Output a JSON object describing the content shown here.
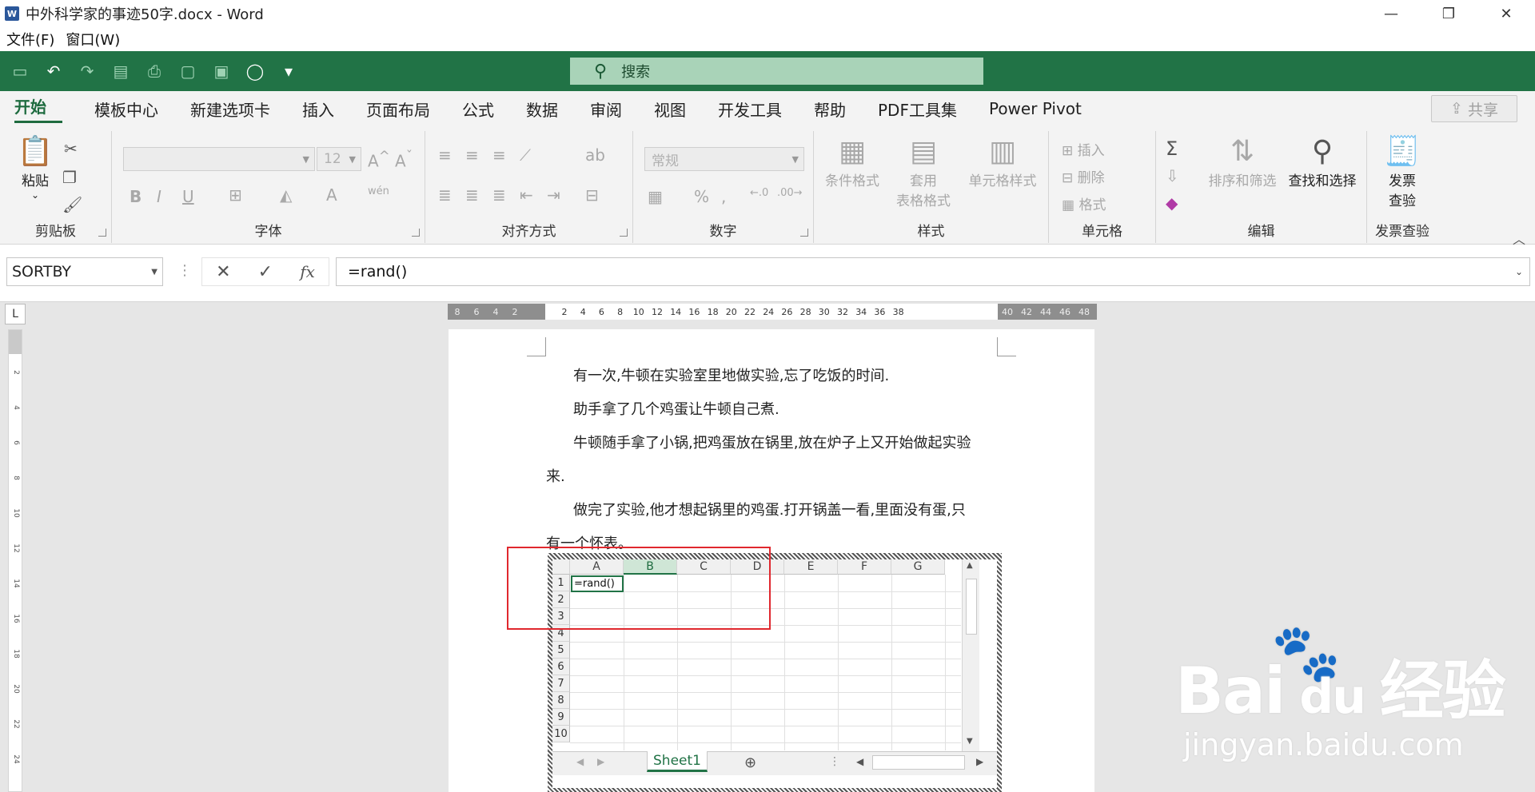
{
  "window": {
    "title": "中外科学家的事迹50字.docx - Word",
    "app_icon_letter": "W",
    "minimize": "—",
    "restore": "❐",
    "close": "✕"
  },
  "menu": {
    "items": [
      "文件(F)",
      "窗口(W)"
    ]
  },
  "qat": {
    "search_placeholder": "搜索"
  },
  "tabs": [
    "开始",
    "模板中心",
    "新建选项卡",
    "插入",
    "页面布局",
    "公式",
    "数据",
    "审阅",
    "视图",
    "开发工具",
    "帮助",
    "PDF工具集",
    "Power Pivot"
  ],
  "share_label": "共享",
  "ribbon": {
    "clipboard": {
      "paste": "粘贴",
      "label": "剪贴板"
    },
    "font": {
      "name": "",
      "size": "12",
      "label": "字体"
    },
    "align": {
      "label": "对齐方式"
    },
    "number": {
      "format": "常规",
      "label": "数字"
    },
    "styles": {
      "cond": "条件格式",
      "table_1": "套用",
      "table_2": "表格格式",
      "cell": "单元格样式",
      "label": "样式"
    },
    "cells": {
      "insert": "插入",
      "delete": "删除",
      "format": "格式",
      "label": "单元格"
    },
    "edit": {
      "sort": "排序和筛选",
      "find": "查找和选择",
      "label": "编辑"
    },
    "invoice": {
      "btn_1": "发票",
      "btn_2": "查验",
      "label": "发票查验"
    }
  },
  "formula_bar": {
    "name_box": "SORTBY",
    "formula": "=rand()",
    "fx": "fx"
  },
  "document": {
    "paragraphs": [
      "有一次,牛顿在实验室里地做实验,忘了吃饭的时间.",
      "助手拿了几个鸡蛋让牛顿自己煮.",
      "牛顿随手拿了小锅,把鸡蛋放在锅里,放在炉子上又开始做起实验",
      "来.",
      "做完了实验,他才想起锅里的鸡蛋.打开锅盖一看,里面没有蛋,只",
      "有一个怀表。"
    ]
  },
  "ruler": {
    "h_ticks_left": [
      "8",
      "6",
      "4",
      "2"
    ],
    "h_ticks_main": [
      "2",
      "4",
      "6",
      "8",
      "10",
      "12",
      "14",
      "16",
      "18",
      "20",
      "22",
      "24",
      "26",
      "28",
      "30",
      "32",
      "34",
      "36",
      "38"
    ],
    "h_ticks_right": [
      "40",
      "42",
      "44",
      "46",
      "48"
    ],
    "v_ticks": [
      "2",
      "4",
      "6",
      "8",
      "10",
      "12",
      "14",
      "16",
      "18",
      "20",
      "22",
      "24"
    ],
    "tab_selector": "L"
  },
  "sheet": {
    "columns": [
      "A",
      "B",
      "C",
      "D",
      "E",
      "F",
      "G"
    ],
    "rows": [
      "1",
      "2",
      "3",
      "4",
      "5",
      "6",
      "7",
      "8",
      "9",
      "10"
    ],
    "active_cell_value": "=rand()",
    "tab_name": "Sheet1"
  },
  "watermark": {
    "main": "Bai",
    "brand_cn": "经验",
    "url": "jingyan.baidu.com"
  },
  "colors": {
    "accent": "#217346",
    "annotation": "#e0282e"
  }
}
